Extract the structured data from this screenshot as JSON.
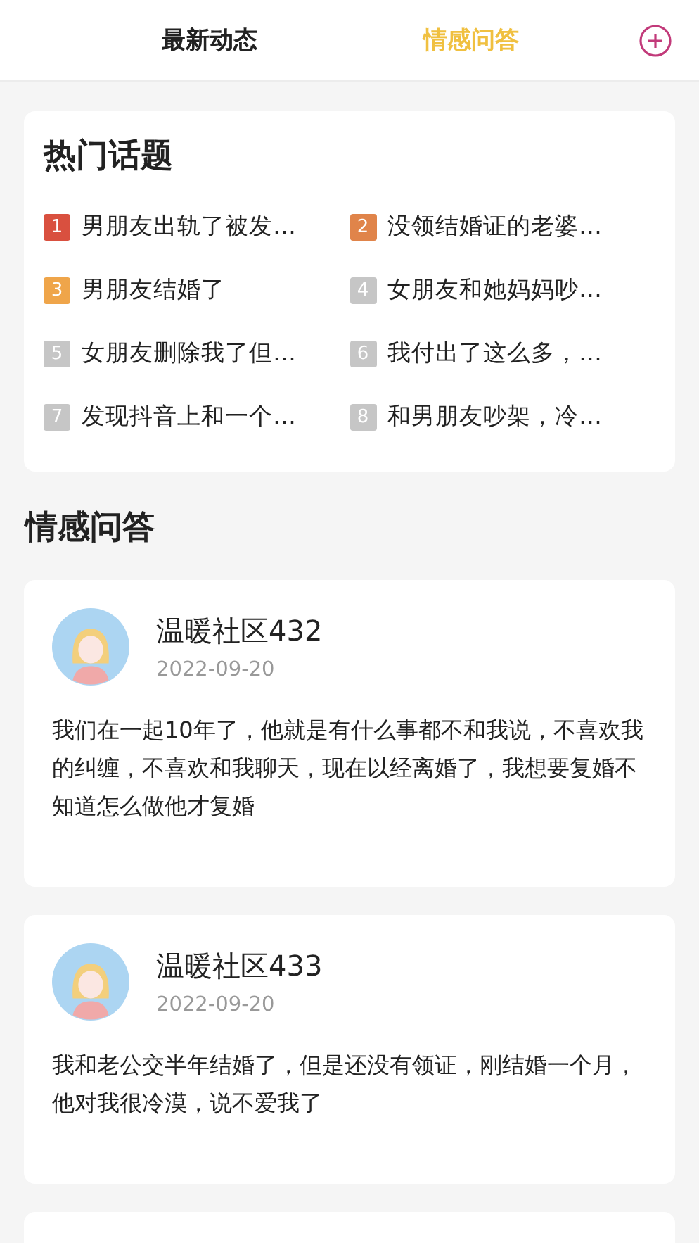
{
  "tabs": [
    {
      "label": "最新动态",
      "selected": false
    },
    {
      "label": "情感问答",
      "selected": true
    }
  ],
  "hot_topics": {
    "title": "热门话题",
    "items": [
      {
        "rank": "1",
        "text": "男朋友出轨了被发…",
        "color": "#d9503f"
      },
      {
        "rank": "2",
        "text": "没领结婚证的老婆…",
        "color": "#e0844a"
      },
      {
        "rank": "3",
        "text": "男朋友结婚了",
        "color": "#efa54a"
      },
      {
        "rank": "4",
        "text": "女朋友和她妈妈吵…",
        "color": "#c6c6c6"
      },
      {
        "rank": "5",
        "text": "女朋友删除我了但…",
        "color": "#c6c6c6"
      },
      {
        "rank": "6",
        "text": "我付出了这么多，…",
        "color": "#c6c6c6"
      },
      {
        "rank": "7",
        "text": "发现抖音上和一个…",
        "color": "#c6c6c6"
      },
      {
        "rank": "8",
        "text": "和男朋友吵架，冷…",
        "color": "#c6c6c6"
      }
    ]
  },
  "qa": {
    "title": "情感问答",
    "posts": [
      {
        "author": "温暖社区432",
        "date": "2022-09-20",
        "text": "我们在一起10年了，他就是有什么事都不和我说，不喜欢我的纠缠，不喜欢和我聊天，现在以经离婚了，我想要复婚不知道怎么做他才复婚"
      },
      {
        "author": "温暖社区433",
        "date": "2022-09-20",
        "text": "我和老公交半年结婚了，但是还没有领证，刚结婚一个月，他对我很冷漠，说不爱我了"
      }
    ]
  }
}
